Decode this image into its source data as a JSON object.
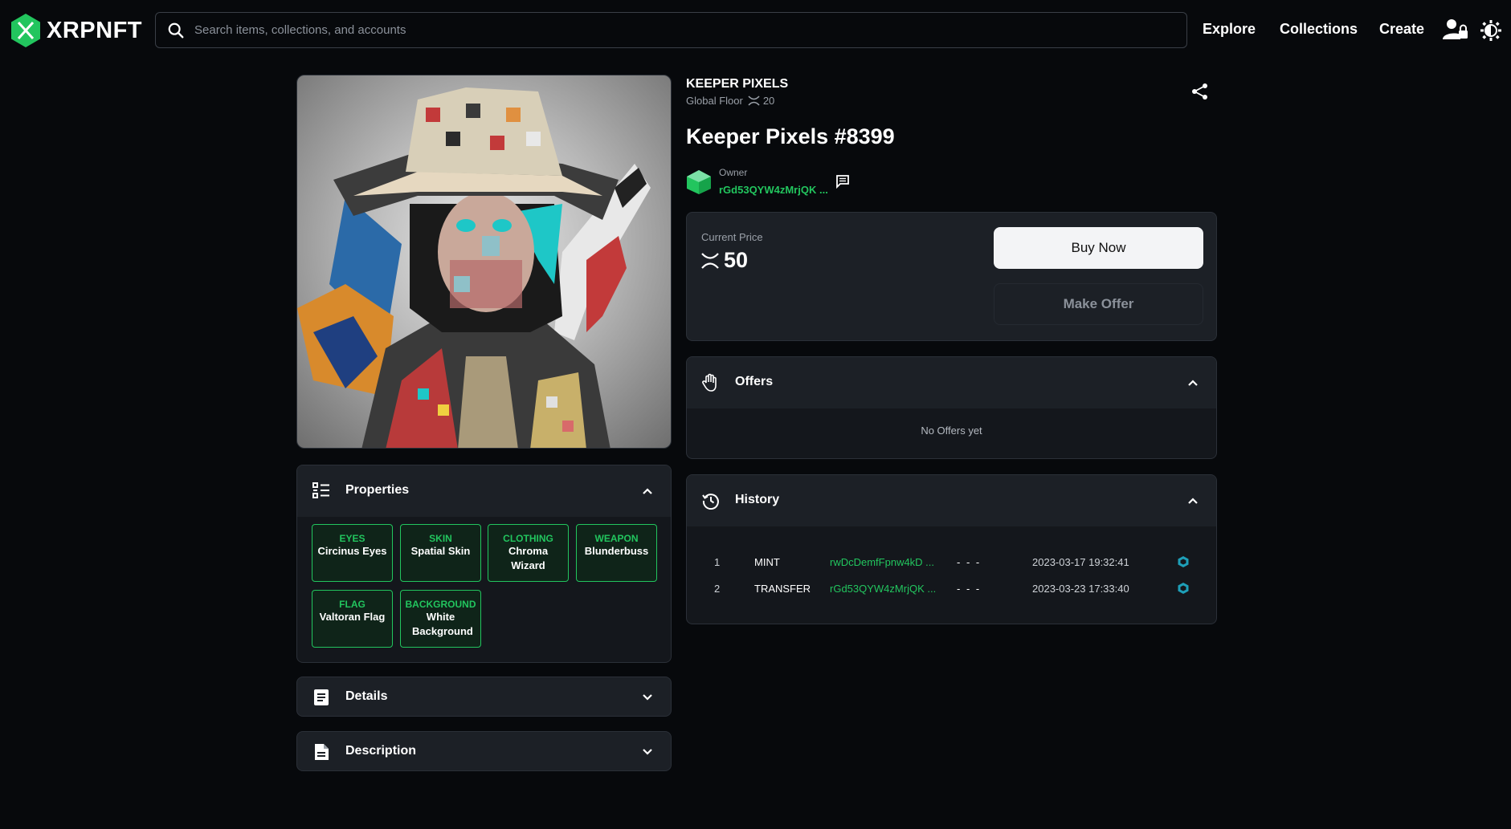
{
  "header": {
    "logo_text": "XRPNFT",
    "search_placeholder": "Search items, collections, and accounts",
    "nav": [
      "Explore",
      "Collections",
      "Create"
    ]
  },
  "collection": {
    "name": "KEEPER PIXELS",
    "floor_label": "Global Floor",
    "floor_value": "20"
  },
  "nft": {
    "title": "Keeper Pixels #8399",
    "owner_label": "Owner",
    "owner_address": "rGd53QYW4zMrjQK ...",
    "price_label": "Current Price",
    "price_value": "50",
    "buy_label": "Buy Now",
    "offer_label": "Make Offer"
  },
  "properties": {
    "title": "Properties",
    "items": [
      {
        "type": "EYES",
        "value": "Circinus Eyes"
      },
      {
        "type": "SKIN",
        "value": "Spatial Skin"
      },
      {
        "type": "CLOTHING",
        "value": "Chroma Wizard"
      },
      {
        "type": "WEAPON",
        "value": "Blunderbuss"
      },
      {
        "type": "FLAG",
        "value": "Valtoran Flag"
      },
      {
        "type": "BACKGROUND",
        "value": "White Background"
      }
    ]
  },
  "details": {
    "title": "Details"
  },
  "description": {
    "title": "Description"
  },
  "offers": {
    "title": "Offers",
    "empty_text": "No Offers yet"
  },
  "history": {
    "title": "History",
    "rows": [
      {
        "num": "1",
        "event": "MINT",
        "address": "rwDcDemfFpnw4kD ...",
        "price": "- - -",
        "date": "2023-03-17 19:32:41"
      },
      {
        "num": "2",
        "event": "TRANSFER",
        "address": "rGd53QYW4zMrjQK ...",
        "price": "- - -",
        "date": "2023-03-23 17:33:40"
      }
    ]
  },
  "colors": {
    "background": "#07090c",
    "panel": "#1c2026",
    "accent_green": "#22c55e",
    "button_light": "#f3f4f6"
  }
}
